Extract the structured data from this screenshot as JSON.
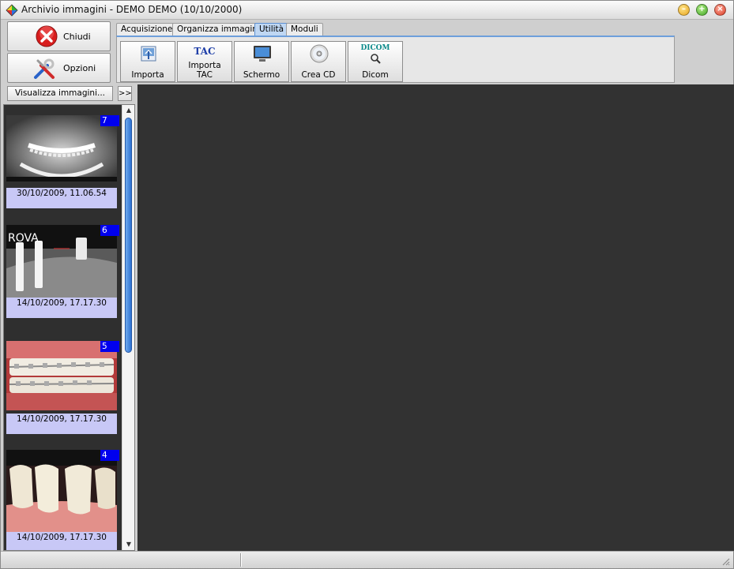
{
  "window": {
    "title": "Archivio immagini - DEMO DEMO (10/10/2000)",
    "controls": [
      "minimize",
      "maximize",
      "close"
    ]
  },
  "actions": {
    "close_label": "Chiudi",
    "options_label": "Opzioni"
  },
  "tabs": [
    {
      "label": "Acquisizione",
      "active": false
    },
    {
      "label": "Organizza immagini",
      "active": false
    },
    {
      "label": "Utilità",
      "active": true
    },
    {
      "label": "Moduli",
      "active": false
    }
  ],
  "tools": [
    {
      "label": "Importa",
      "icon": "import-icon"
    },
    {
      "label": "Importa\nTAC",
      "icon": "tac-icon",
      "icon_text": "TAC"
    },
    {
      "label": "Schermo",
      "icon": "monitor-icon"
    },
    {
      "label": "Crea CD",
      "icon": "cd-icon"
    },
    {
      "label": "Dicom",
      "icon": "dicom-icon",
      "icon_text": "DICOM"
    }
  ],
  "left_panel": {
    "view_button": "Visualizza immagini...",
    "expand_button": ">>"
  },
  "thumbnails": [
    {
      "number": "7",
      "date": "30/10/2009, 11.06.54",
      "kind": "panoramic-xray"
    },
    {
      "number": "6",
      "date": "14/10/2009, 17.17.30",
      "kind": "implant-xray",
      "overlay_text": "ROVA"
    },
    {
      "number": "5",
      "date": "14/10/2009, 17.17.30",
      "kind": "braces-photo"
    },
    {
      "number": "4",
      "date": "14/10/2009, 17.17.30",
      "kind": "teeth-photo"
    }
  ],
  "colors": {
    "thumb_number_bg": "#0000ee",
    "thumb_date_bg": "#c8c8f6",
    "viewer_bg": "#323232",
    "tab_accent": "#6e9fdb"
  }
}
